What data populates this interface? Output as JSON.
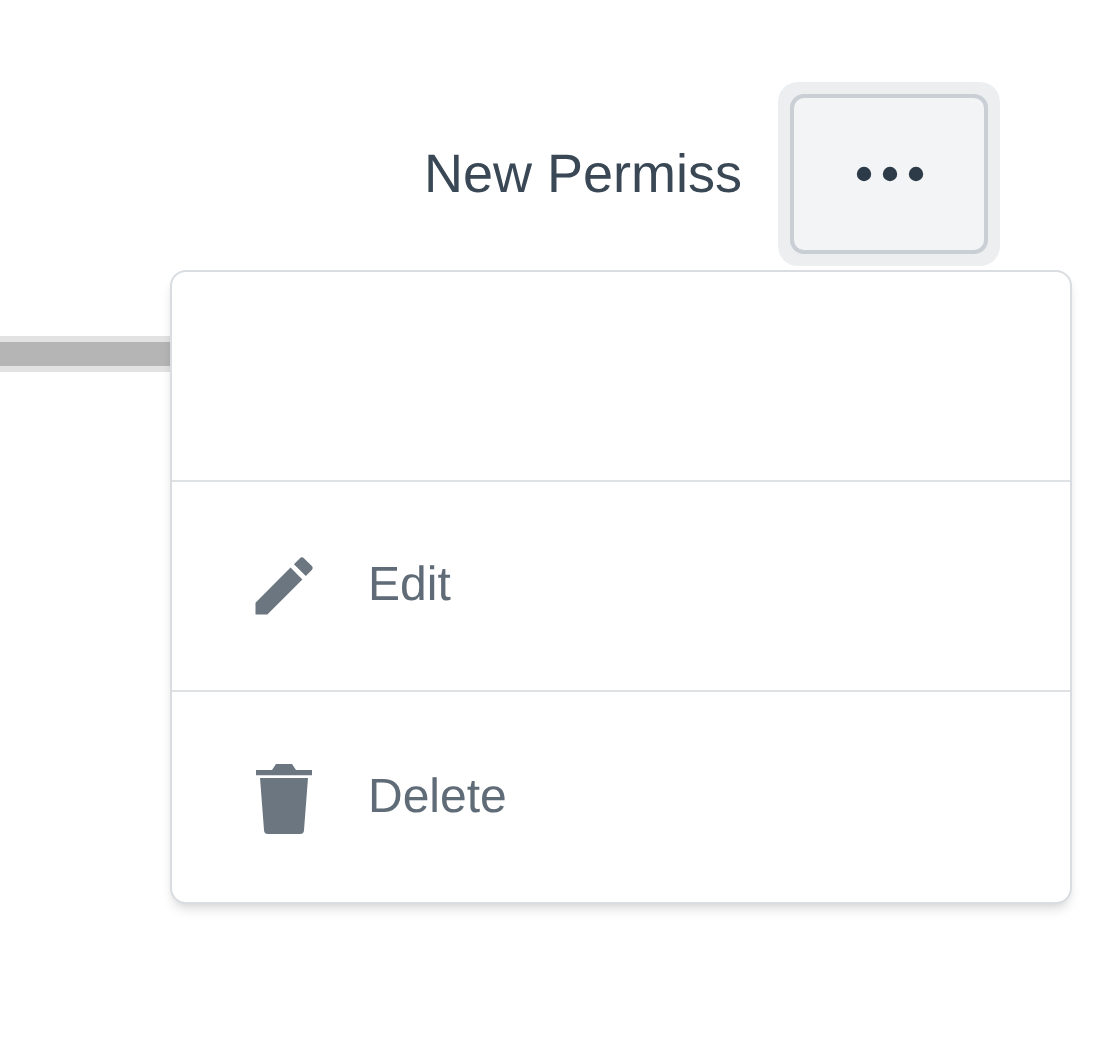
{
  "header": {
    "title": "New Permiss"
  },
  "menu": {
    "items": [
      {
        "kind": "edit",
        "label": "Edit"
      },
      {
        "kind": "delete",
        "label": "Delete"
      }
    ]
  }
}
